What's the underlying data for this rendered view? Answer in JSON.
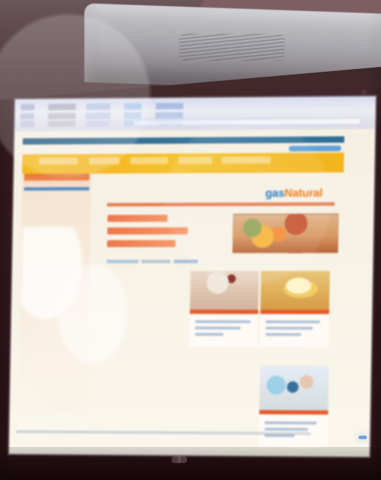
{
  "scene": {
    "brand_name": "gasNatural",
    "brand_colors": {
      "blue": "#1f7cc2",
      "orange": "#f07e1b"
    },
    "icons": [
      "monitor",
      "power-indicator-icon"
    ]
  }
}
